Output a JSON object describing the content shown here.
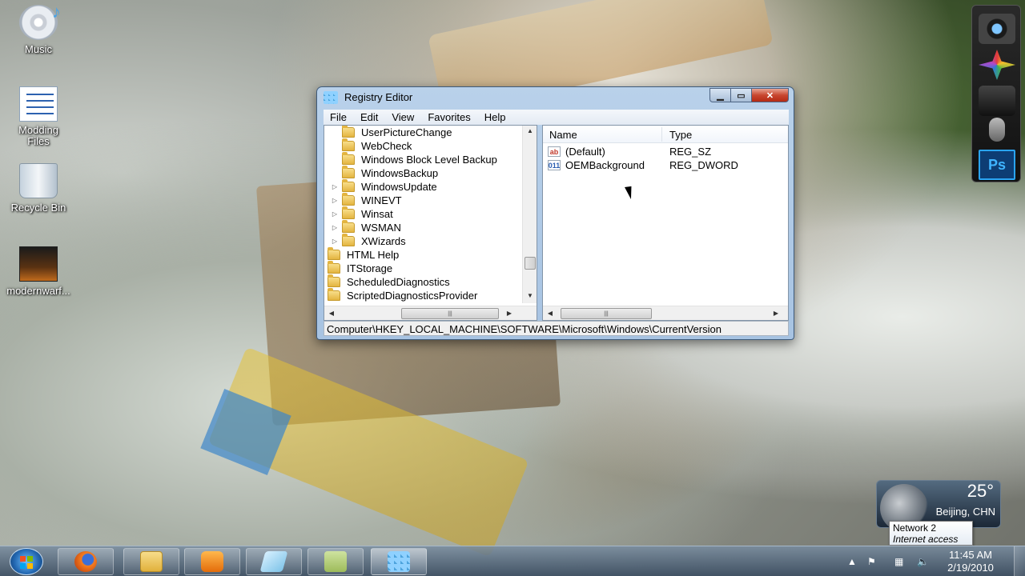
{
  "desktop": {
    "icons": [
      {
        "label": "Music",
        "icon": "cd-music-icon"
      },
      {
        "label": "Modding Files",
        "icon": "document-icon"
      },
      {
        "label": "Recycle Bin",
        "icon": "recycle-bin-icon"
      },
      {
        "label": "modernwarf...",
        "icon": "game-shortcut-icon"
      }
    ]
  },
  "window": {
    "title": "Registry Editor",
    "menu": [
      "File",
      "Edit",
      "View",
      "Favorites",
      "Help"
    ],
    "tree": [
      {
        "label": "UserPictureChange",
        "expander": ""
      },
      {
        "label": "WebCheck",
        "expander": ""
      },
      {
        "label": "Windows Block Level Backup",
        "expander": ""
      },
      {
        "label": "WindowsBackup",
        "expander": ""
      },
      {
        "label": "WindowsUpdate",
        "expander": "▷"
      },
      {
        "label": "WINEVT",
        "expander": "▷"
      },
      {
        "label": "Winsat",
        "expander": "▷"
      },
      {
        "label": "WSMAN",
        "expander": "▷"
      },
      {
        "label": "XWizards",
        "expander": "▷"
      },
      {
        "label": "HTML Help",
        "expander": ""
      },
      {
        "label": "ITStorage",
        "expander": ""
      },
      {
        "label": "ScheduledDiagnostics",
        "expander": ""
      },
      {
        "label": "ScriptedDiagnosticsProvider",
        "expander": ""
      }
    ],
    "values_header": {
      "name": "Name",
      "type": "Type"
    },
    "values": [
      {
        "name": "(Default)",
        "type": "REG_SZ",
        "icon_text": "ab"
      },
      {
        "name": "OEMBackground",
        "type": "REG_DWORD",
        "icon_text": "011"
      }
    ],
    "status_path": "Computer\\HKEY_LOCAL_MACHINE\\SOFTWARE\\Microsoft\\Windows\\CurrentVersion"
  },
  "weather": {
    "temperature": "25°",
    "city": "Beijing, CHN"
  },
  "network_tooltip": {
    "title": "Network  2",
    "subtitle": "Internet access"
  },
  "clock": {
    "time": "11:45 AM",
    "date": "2/19/2010"
  },
  "taskbar": {
    "apps": [
      "firefox-icon",
      "windows-explorer-icon",
      "media-player-icon",
      "glass-app-icon",
      "sticky-notes-icon",
      "registry-editor-icon"
    ],
    "tray_icons": [
      "show-hidden-icons-icon",
      "action-center-icon",
      "network-icon",
      "volume-icon"
    ]
  }
}
